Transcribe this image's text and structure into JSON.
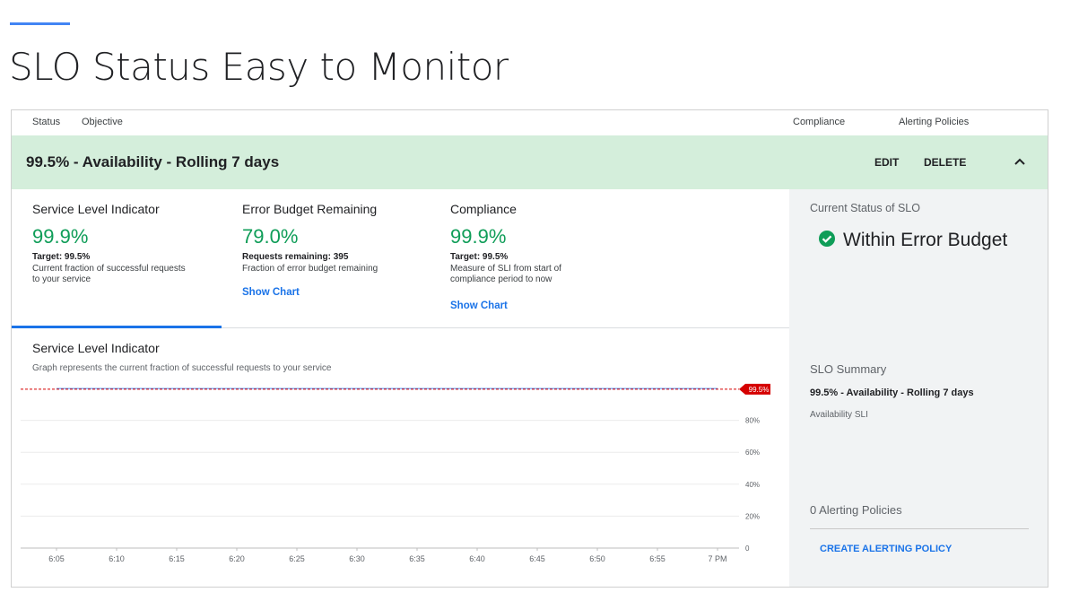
{
  "slide": {
    "title": "SLO Status Easy to Monitor"
  },
  "columns": {
    "status": "Status",
    "objective": "Objective",
    "compliance": "Compliance",
    "alerting": "Alerting Policies"
  },
  "slo": {
    "name": "99.5% - Availability - Rolling 7 days",
    "edit_label": "EDIT",
    "delete_label": "DELETE"
  },
  "metrics": [
    {
      "title": "Service Level Indicator",
      "value": "99.9%",
      "target": "Target: 99.5%",
      "description": "Current fraction of successful requests to your service"
    },
    {
      "title": "Error Budget Remaining",
      "value": "79.0%",
      "target": "Requests remaining: 395",
      "description": "Fraction of error budget remaining",
      "link": "Show Chart"
    },
    {
      "title": "Compliance",
      "value": "99.9%",
      "target": "Target: 99.5%",
      "description": "Measure of SLI from start of compliance period to now",
      "link": "Show Chart"
    }
  ],
  "chart_section": {
    "title": "Service Level Indicator",
    "subtitle": "Graph represents the current fraction of successful requests to your service"
  },
  "chart_data": {
    "type": "line",
    "x": [
      "6:05",
      "6:10",
      "6:15",
      "6:20",
      "6:25",
      "6:30",
      "6:35",
      "6:40",
      "6:45",
      "6:50",
      "6:55",
      "7 PM"
    ],
    "y_ticks": [
      "0",
      "20%",
      "40%",
      "60%",
      "80%"
    ],
    "ylim": [
      0,
      100
    ],
    "target": {
      "value": 99.5,
      "label": "99.5%",
      "color": "#d50000"
    },
    "series": [
      {
        "values": [
          99.9,
          99.9,
          99.9,
          99.9,
          99.9,
          99.9,
          99.9,
          99.9,
          99.9,
          99.9,
          99.9,
          99.9
        ],
        "color": "#4a8cf7"
      }
    ],
    "grid": true
  },
  "side": {
    "status_heading": "Current Status of SLO",
    "status_text": "Within Error Budget",
    "status_color": "#0f9d58",
    "summary_heading": "SLO Summary",
    "summary_name": "99.5% - Availability - Rolling 7 days",
    "summary_sli": "Availability SLI",
    "alert_heading": "0 Alerting Policies",
    "alert_button": "CREATE ALERTING POLICY"
  }
}
